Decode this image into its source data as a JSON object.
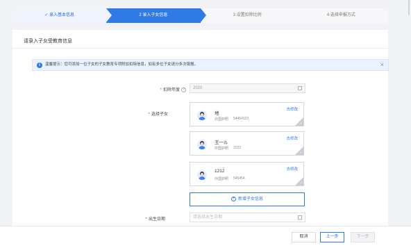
{
  "steps": [
    {
      "label": "✓ 录入基本信息",
      "state": "done"
    },
    {
      "label": "2 录入子女信息",
      "state": "active"
    },
    {
      "label": "3 设置扣除比例",
      "state": "todo"
    },
    {
      "label": "4 选择申报方式",
      "state": "todo"
    }
  ],
  "panel": {
    "title": "请录入子女受教育信息"
  },
  "tip": {
    "icon": "i",
    "text": "温馨提示：您可添加一位子女的子女教育专项附加扣除信息，如有多位子女请分多次填报。",
    "close": "×"
  },
  "form": {
    "year_label": "扣除年度",
    "year_help": "?",
    "year_value": "2020",
    "child_label": "选择子女",
    "birth_label": "出生日期",
    "birth_placeholder": "请选择出生日期"
  },
  "children": [
    {
      "name": "地",
      "id_type": "外国护照",
      "id_no": "54454122",
      "edit": "去修改"
    },
    {
      "name": "王一ル",
      "id_type": "中国护照",
      "id_no": "2222",
      "edit": "去修改"
    },
    {
      "name": "1212",
      "id_type": "外国护照",
      "id_no": "545454",
      "edit": "去修改"
    }
  ],
  "add_child": {
    "icon": "+",
    "label": "新增子女信息"
  },
  "footer": {
    "cancel": "取消",
    "prev": "上一步",
    "next": "下一步"
  },
  "icons": {
    "tip": "info-icon",
    "close": "close-icon",
    "help": "help-icon",
    "calendar": "calendar-icon",
    "avatar": "child-avatar-icon",
    "check_corner": "selected-corner-icon",
    "add": "plus-circle-icon"
  },
  "colors": {
    "accent": "#2f7ae5",
    "required": "#e54545",
    "tip_bg": "#eaf2fd"
  }
}
